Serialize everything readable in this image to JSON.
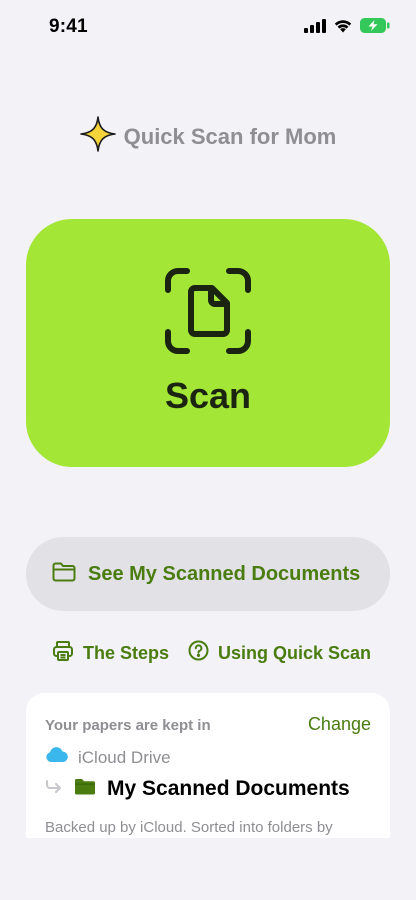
{
  "status_bar": {
    "time": "9:41",
    "icons": [
      "cellular-signal-icon",
      "wifi-icon",
      "battery-charging-icon"
    ]
  },
  "app": {
    "title": "Quick Scan for Mom",
    "title_icon": "sparkle-icon"
  },
  "scan_button": {
    "label": "Scan",
    "icon": "document-scan-icon"
  },
  "documents_button": {
    "label": "See My Scanned Documents",
    "icon": "folder-icon"
  },
  "help_links": [
    {
      "label": "The Steps",
      "icon": "printer-icon"
    },
    {
      "label": "Using Quick Scan",
      "icon": "question-circle-icon"
    }
  ],
  "storage": {
    "caption": "Your papers are kept in",
    "change_label": "Change",
    "provider": "iCloud Drive",
    "folder": "My Scanned Documents",
    "note": "Backed up by iCloud. Sorted into folders by"
  },
  "colors": {
    "background": "#f2f2f7",
    "accent_green": "#a3e635",
    "link_green": "#4a7c10",
    "secondary_gray": "#8e8e93",
    "pill_gray": "#e2e2e6",
    "icloud_blue": "#3ab7ec",
    "sparkle_yellow": "#f5d33b",
    "battery_green": "#34c759"
  }
}
